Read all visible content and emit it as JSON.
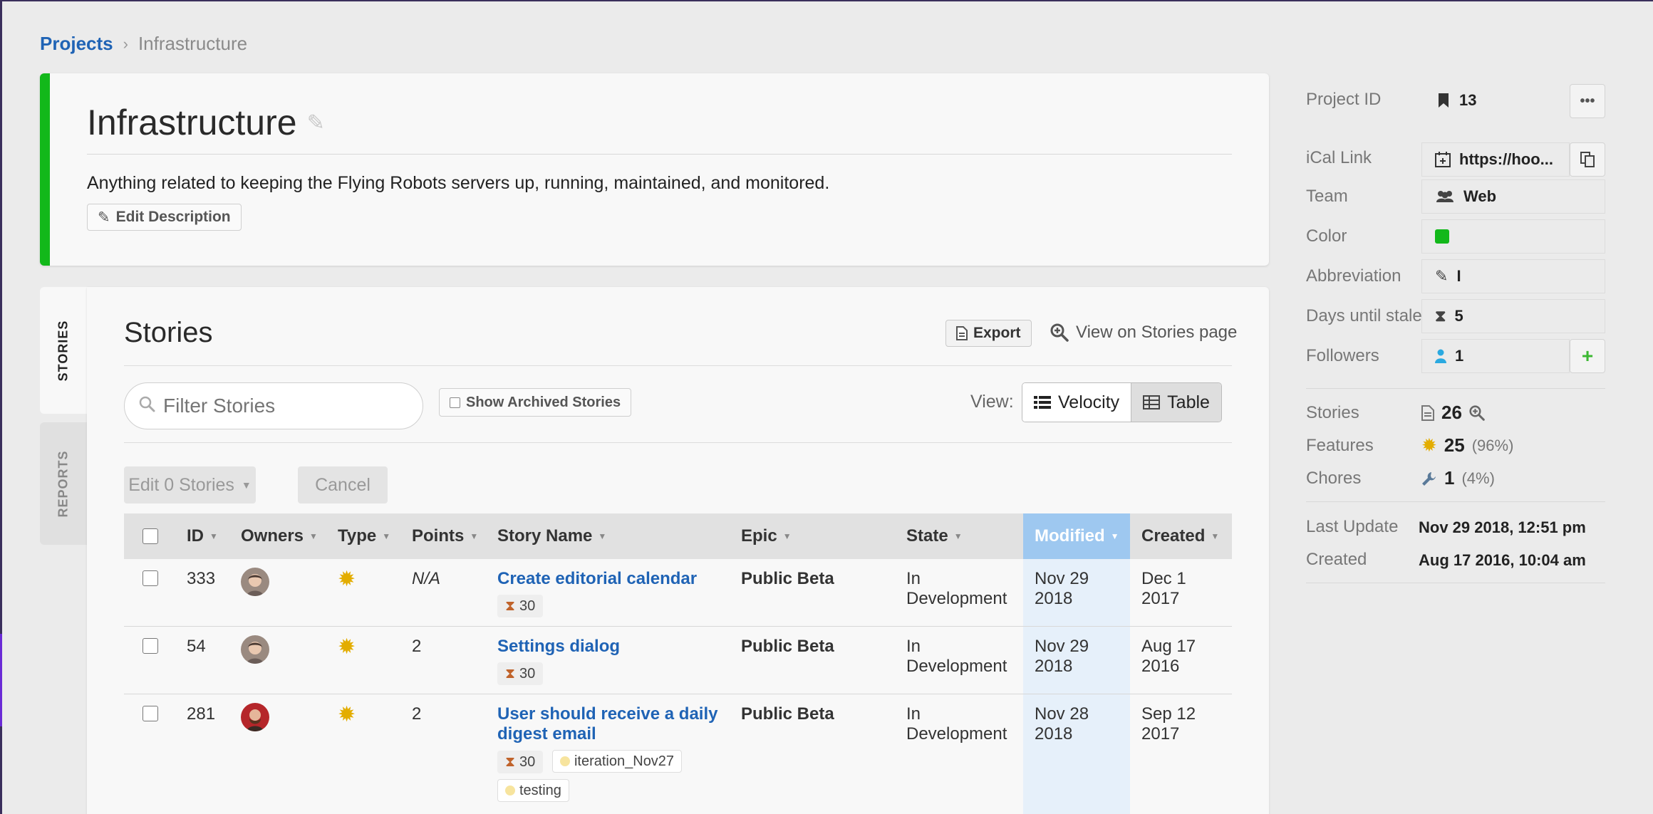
{
  "breadcrumb": {
    "root": "Projects",
    "separator": "›",
    "current": "Infrastructure"
  },
  "project": {
    "name": "Infrastructure",
    "description": "Anything related to keeping the Flying Robots servers up, running, maintained, and monitored.",
    "edit_description_label": "Edit Description",
    "color": "#12b81a"
  },
  "tabs": {
    "stories": "STORIES",
    "reports": "REPORTS"
  },
  "stories": {
    "title": "Stories",
    "export_label": "Export",
    "view_link_label": "View on Stories page",
    "filter_placeholder": "Filter Stories",
    "show_archived_label": "Show Archived Stories",
    "view_label": "View:",
    "view_options": {
      "velocity": "Velocity",
      "table": "Table"
    },
    "edit_label": "Edit 0 Stories",
    "cancel_label": "Cancel"
  },
  "table": {
    "headers": {
      "id": "ID",
      "owners": "Owners",
      "type": "Type",
      "points": "Points",
      "story_name": "Story Name",
      "epic": "Epic",
      "state": "State",
      "modified": "Modified",
      "created": "Created"
    },
    "rows": [
      {
        "id": "333",
        "type_icon": "feature-icon",
        "points": "N/A",
        "name": "Create editorial calendar",
        "estimate": "30",
        "labels": [],
        "epic": "Public Beta",
        "state_line1": "In",
        "state_line2": "Development",
        "modified_line1": "Nov 29",
        "modified_line2": "2018",
        "created_line1": "Dec 1",
        "created_line2": "2017"
      },
      {
        "id": "54",
        "type_icon": "feature-icon",
        "points": "2",
        "name": "Settings dialog",
        "estimate": "30",
        "labels": [],
        "epic": "Public Beta",
        "state_line1": "In",
        "state_line2": "Development",
        "modified_line1": "Nov 29",
        "modified_line2": "2018",
        "created_line1": "Aug 17",
        "created_line2": "2016"
      },
      {
        "id": "281",
        "type_icon": "feature-icon",
        "points": "2",
        "name_line1": "User should receive a daily",
        "name_line2": "digest email",
        "estimate": "30",
        "labels": [
          "iteration_Nov27",
          "testing"
        ],
        "epic": "Public Beta",
        "state_line1": "In",
        "state_line2": "Development",
        "modified_line1": "Nov 28",
        "modified_line2": "2018",
        "created_line1": "Sep 12",
        "created_line2": "2017"
      }
    ]
  },
  "sidebar": {
    "project_id_label": "Project ID",
    "project_id": "13",
    "more_label": "•••",
    "ical_label": "iCal Link",
    "ical_value": "https://hoo...",
    "team_label": "Team",
    "team_value": "Web",
    "color_label": "Color",
    "abbrev_label": "Abbreviation",
    "abbrev_value": "I",
    "stale_label": "Days until stale",
    "stale_value": "5",
    "followers_label": "Followers",
    "followers_value": "1",
    "stories_label": "Stories",
    "stories_count": "26",
    "features_label": "Features",
    "features_count": "25",
    "features_pct": "(96%)",
    "chores_label": "Chores",
    "chores_count": "1",
    "chores_pct": "(4%)",
    "last_update_label": "Last Update",
    "last_update_value": "Nov 29 2018, 12:51 pm",
    "created_label": "Created",
    "created_value": "Aug 17 2016, 10:04 am"
  }
}
